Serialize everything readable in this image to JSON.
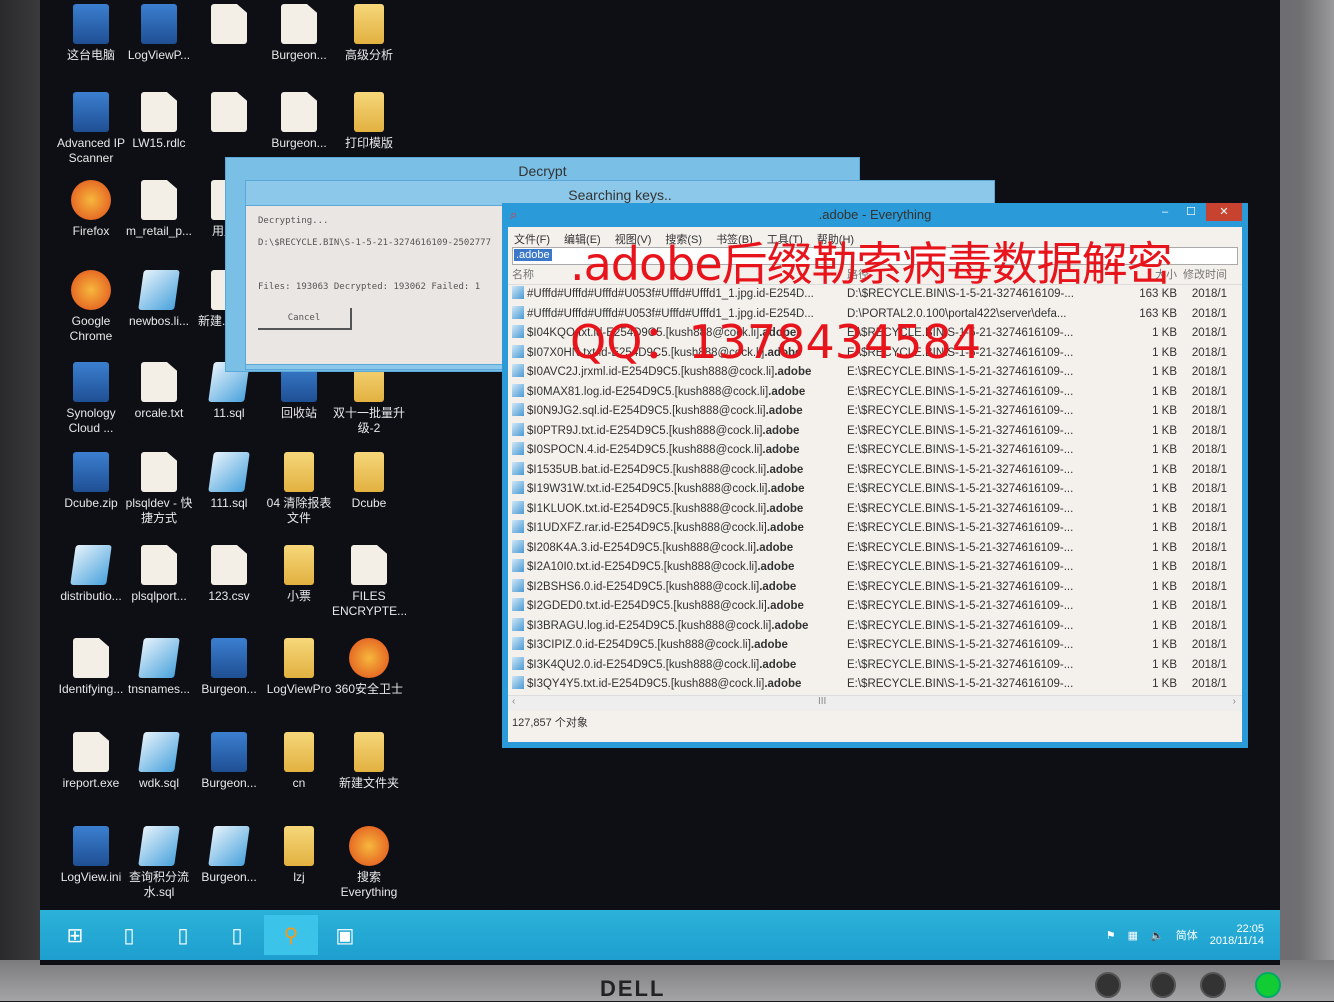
{
  "desktop_icons": [
    {
      "label": "这台电脑",
      "kind": "app"
    },
    {
      "label": "LogViewP...",
      "kind": "app"
    },
    {
      "label": "",
      "kind": "doc"
    },
    {
      "label": "Burgeon...",
      "kind": "doc"
    },
    {
      "label": "高级分析",
      "kind": "folder"
    },
    {
      "label": "Advanced IP Scanner",
      "kind": "app"
    },
    {
      "label": "LW15.rdlc",
      "kind": "doc"
    },
    {
      "label": "",
      "kind": "doc"
    },
    {
      "label": "Burgeon...",
      "kind": "doc"
    },
    {
      "label": "打印模版",
      "kind": "folder"
    },
    {
      "label": "Firefox",
      "kind": "round"
    },
    {
      "label": "m_retail_p...",
      "kind": "doc"
    },
    {
      "label": "用户...",
      "kind": "doc"
    },
    {
      "label": "",
      "kind": "hidden"
    },
    {
      "label": "",
      "kind": "hidden"
    },
    {
      "label": "Google Chrome",
      "kind": "round"
    },
    {
      "label": "newbos.li...",
      "kind": "sql"
    },
    {
      "label": "新建...档.txt",
      "kind": "doc"
    },
    {
      "label": "",
      "kind": "hidden"
    },
    {
      "label": "",
      "kind": "hidden"
    },
    {
      "label": "Synology Cloud ...",
      "kind": "app"
    },
    {
      "label": "orcale.txt",
      "kind": "doc"
    },
    {
      "label": "11.sql",
      "kind": "sql"
    },
    {
      "label": "回收站",
      "kind": "app"
    },
    {
      "label": "双十一批量升级-2",
      "kind": "folder"
    },
    {
      "label": "Dcube.zip",
      "kind": "app"
    },
    {
      "label": "plsqldev - 快捷方式",
      "kind": "doc"
    },
    {
      "label": "111.sql",
      "kind": "sql"
    },
    {
      "label": "04 清除报表文件",
      "kind": "folder"
    },
    {
      "label": "Dcube",
      "kind": "folder"
    },
    {
      "label": "distributio...",
      "kind": "sql"
    },
    {
      "label": "plsqlport...",
      "kind": "doc"
    },
    {
      "label": "123.csv",
      "kind": "doc"
    },
    {
      "label": "小票",
      "kind": "folder"
    },
    {
      "label": "FILES ENCRYPTE...",
      "kind": "doc"
    },
    {
      "label": "Identifying...",
      "kind": "doc"
    },
    {
      "label": "tnsnames...",
      "kind": "sql"
    },
    {
      "label": "Burgeon...",
      "kind": "app"
    },
    {
      "label": "LogViewPro",
      "kind": "folder"
    },
    {
      "label": "360安全卫士",
      "kind": "round"
    },
    {
      "label": "ireport.exe",
      "kind": "doc"
    },
    {
      "label": "wdk.sql",
      "kind": "sql"
    },
    {
      "label": "Burgeon...",
      "kind": "app"
    },
    {
      "label": "cn",
      "kind": "folder"
    },
    {
      "label": "新建文件夹",
      "kind": "folder"
    },
    {
      "label": "LogView.ini",
      "kind": "app"
    },
    {
      "label": "查询积分流水.sql",
      "kind": "sql"
    },
    {
      "label": "Burgeon...",
      "kind": "sql"
    },
    {
      "label": "lzj",
      "kind": "folder"
    },
    {
      "label": "搜索 Everything",
      "kind": "round"
    }
  ],
  "decrypt_window": {
    "title": "Decrypt"
  },
  "search_window": {
    "title": "Searching keys.."
  },
  "progress_dialog": {
    "status": "Decrypting...",
    "current_path": "D:\\$RECYCLE.BIN\\S-1-5-21-3274616109-2502777",
    "counts": "Files: 193063 Decrypted: 193062 Failed: 1",
    "cancel_label": "Cancel"
  },
  "everything": {
    "title": ".adobe - Everything",
    "menu": [
      "文件(F)",
      "编辑(E)",
      "视图(V)",
      "搜索(S)",
      "书签(B)",
      "工具(T)",
      "帮助(H)"
    ],
    "search_value": ".adobe",
    "columns": {
      "name": "名称",
      "path": "路径",
      "size": "大小",
      "modified": "修改时间"
    },
    "rows": [
      {
        "name": "#Ufffd#Ufffd#Ufffd#U053f#Ufffd#Ufffd1_1.jpg.id-E254D...",
        "ext": "",
        "path": "D:\\$RECYCLE.BIN\\S-1-5-21-3274616109-...",
        "size": "163 KB",
        "date": "2018/1"
      },
      {
        "name": "#Ufffd#Ufffd#Ufffd#U053f#Ufffd#Ufffd1_1.jpg.id-E254D...",
        "ext": "",
        "path": "D:\\PORTAL2.0.100\\portal422\\server\\defa...",
        "size": "163 KB",
        "date": "2018/1"
      },
      {
        "name": "$I04KQO.txt.id-E254D9C5.[kush888@cock.li]",
        "ext": ".adobe",
        "path": "E:\\$RECYCLE.BIN\\S-1-5-21-3274616109-...",
        "size": "1 KB",
        "date": "2018/1"
      },
      {
        "name": "$I07X0HN.txt.id-E254D9C5.[kush888@cock.li]",
        "ext": ".adobe",
        "path": "E:\\$RECYCLE.BIN\\S-1-5-21-3274616109-...",
        "size": "1 KB",
        "date": "2018/1"
      },
      {
        "name": "$I0AVC2J.jrxml.id-E254D9C5.[kush888@cock.li]",
        "ext": ".adobe",
        "path": "E:\\$RECYCLE.BIN\\S-1-5-21-3274616109-...",
        "size": "1 KB",
        "date": "2018/1"
      },
      {
        "name": "$I0MAX81.log.id-E254D9C5.[kush888@cock.li]",
        "ext": ".adobe",
        "path": "E:\\$RECYCLE.BIN\\S-1-5-21-3274616109-...",
        "size": "1 KB",
        "date": "2018/1"
      },
      {
        "name": "$I0N9JG2.sql.id-E254D9C5.[kush888@cock.li]",
        "ext": ".adobe",
        "path": "E:\\$RECYCLE.BIN\\S-1-5-21-3274616109-...",
        "size": "1 KB",
        "date": "2018/1"
      },
      {
        "name": "$I0PTR9J.txt.id-E254D9C5.[kush888@cock.li]",
        "ext": ".adobe",
        "path": "E:\\$RECYCLE.BIN\\S-1-5-21-3274616109-...",
        "size": "1 KB",
        "date": "2018/1"
      },
      {
        "name": "$I0SPOCN.4.id-E254D9C5.[kush888@cock.li]",
        "ext": ".adobe",
        "path": "E:\\$RECYCLE.BIN\\S-1-5-21-3274616109-...",
        "size": "1 KB",
        "date": "2018/1"
      },
      {
        "name": "$I1535UB.bat.id-E254D9C5.[kush888@cock.li]",
        "ext": ".adobe",
        "path": "E:\\$RECYCLE.BIN\\S-1-5-21-3274616109-...",
        "size": "1 KB",
        "date": "2018/1"
      },
      {
        "name": "$I19W31W.txt.id-E254D9C5.[kush888@cock.li]",
        "ext": ".adobe",
        "path": "E:\\$RECYCLE.BIN\\S-1-5-21-3274616109-...",
        "size": "1 KB",
        "date": "2018/1"
      },
      {
        "name": "$I1KLUOK.txt.id-E254D9C5.[kush888@cock.li]",
        "ext": ".adobe",
        "path": "E:\\$RECYCLE.BIN\\S-1-5-21-3274616109-...",
        "size": "1 KB",
        "date": "2018/1"
      },
      {
        "name": "$I1UDXFZ.rar.id-E254D9C5.[kush888@cock.li]",
        "ext": ".adobe",
        "path": "E:\\$RECYCLE.BIN\\S-1-5-21-3274616109-...",
        "size": "1 KB",
        "date": "2018/1"
      },
      {
        "name": "$I208K4A.3.id-E254D9C5.[kush888@cock.li]",
        "ext": ".adobe",
        "path": "E:\\$RECYCLE.BIN\\S-1-5-21-3274616109-...",
        "size": "1 KB",
        "date": "2018/1"
      },
      {
        "name": "$I2A10I0.txt.id-E254D9C5.[kush888@cock.li]",
        "ext": ".adobe",
        "path": "E:\\$RECYCLE.BIN\\S-1-5-21-3274616109-...",
        "size": "1 KB",
        "date": "2018/1"
      },
      {
        "name": "$I2BSHS6.0.id-E254D9C5.[kush888@cock.li]",
        "ext": ".adobe",
        "path": "E:\\$RECYCLE.BIN\\S-1-5-21-3274616109-...",
        "size": "1 KB",
        "date": "2018/1"
      },
      {
        "name": "$I2GDED0.txt.id-E254D9C5.[kush888@cock.li]",
        "ext": ".adobe",
        "path": "E:\\$RECYCLE.BIN\\S-1-5-21-3274616109-...",
        "size": "1 KB",
        "date": "2018/1"
      },
      {
        "name": "$I3BRAGU.log.id-E254D9C5.[kush888@cock.li]",
        "ext": ".adobe",
        "path": "E:\\$RECYCLE.BIN\\S-1-5-21-3274616109-...",
        "size": "1 KB",
        "date": "2018/1"
      },
      {
        "name": "$I3CIPIZ.0.id-E254D9C5.[kush888@cock.li]",
        "ext": ".adobe",
        "path": "E:\\$RECYCLE.BIN\\S-1-5-21-3274616109-...",
        "size": "1 KB",
        "date": "2018/1"
      },
      {
        "name": "$I3K4QU2.0.id-E254D9C5.[kush888@cock.li]",
        "ext": ".adobe",
        "path": "E:\\$RECYCLE.BIN\\S-1-5-21-3274616109-...",
        "size": "1 KB",
        "date": "2018/1"
      },
      {
        "name": "$I3QY4Y5.txt.id-E254D9C5.[kush888@cock.li]",
        "ext": ".adobe",
        "path": "E:\\$RECYCLE.BIN\\S-1-5-21-3274616109-...",
        "size": "1 KB",
        "date": "2018/1"
      }
    ],
    "status": "127,857 个对象"
  },
  "overlay": {
    "headline": ".adobe后缀勒索病毒数据解密",
    "contact": "QQ：1378434584"
  },
  "taskbar": {
    "tray_lang": "简体",
    "time": "22:05",
    "date": "2018/11/14"
  },
  "monitor_brand": "DELL",
  "colors": {
    "taskbar": "#22a8d5",
    "window_frame": "#2a9ad8",
    "overlay_text": "#e8141c"
  }
}
